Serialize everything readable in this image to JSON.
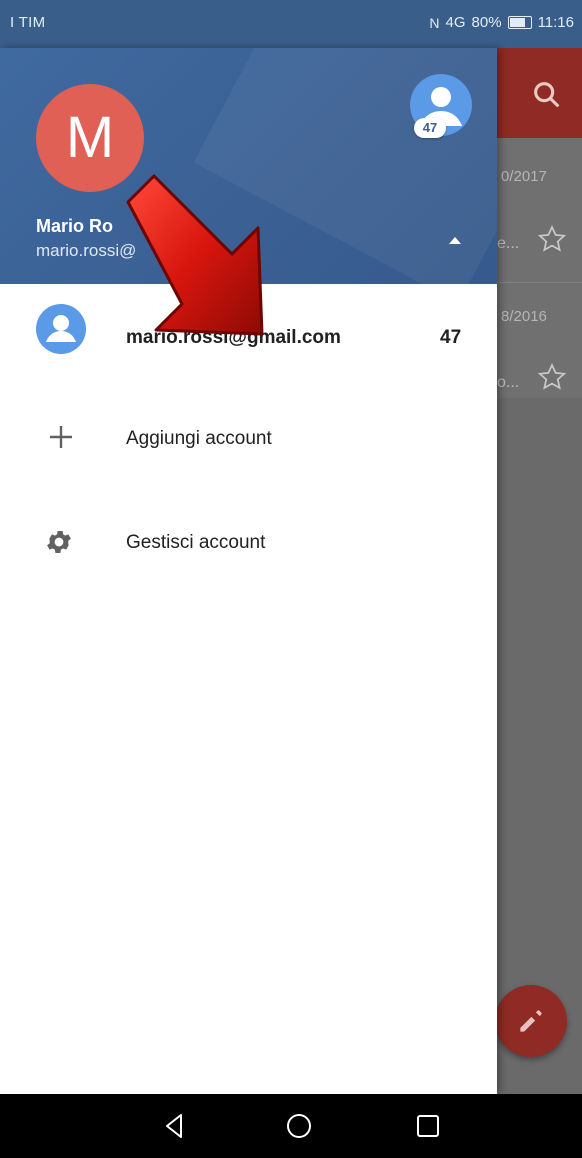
{
  "status_bar": {
    "carrier": "I TIM",
    "signal": "4G",
    "battery": "80%",
    "time": "11:16"
  },
  "background_app": {
    "rows": [
      {
        "date": "0/2017",
        "snippet": "e..."
      },
      {
        "date": "8/2016",
        "snippet": "o..."
      }
    ]
  },
  "drawer": {
    "header": {
      "avatar_letter": "M",
      "other_accounts_badge": "47",
      "account_name": "Mario Ro",
      "account_email": "mario.rossi@"
    },
    "accounts": [
      {
        "email": "mario.rossi@gmail.com",
        "count": "47",
        "icon": "account-circle-icon"
      }
    ],
    "menu": [
      {
        "label": "Aggiungi account",
        "icon": "plus-icon"
      },
      {
        "label": "Gestisci account",
        "icon": "gear-icon"
      }
    ]
  },
  "colors": {
    "header_blue": "#3d6699",
    "gmail_red": "#8f2a24",
    "avatar_red": "#e06055",
    "account_icon_blue": "#5a9ae6"
  }
}
